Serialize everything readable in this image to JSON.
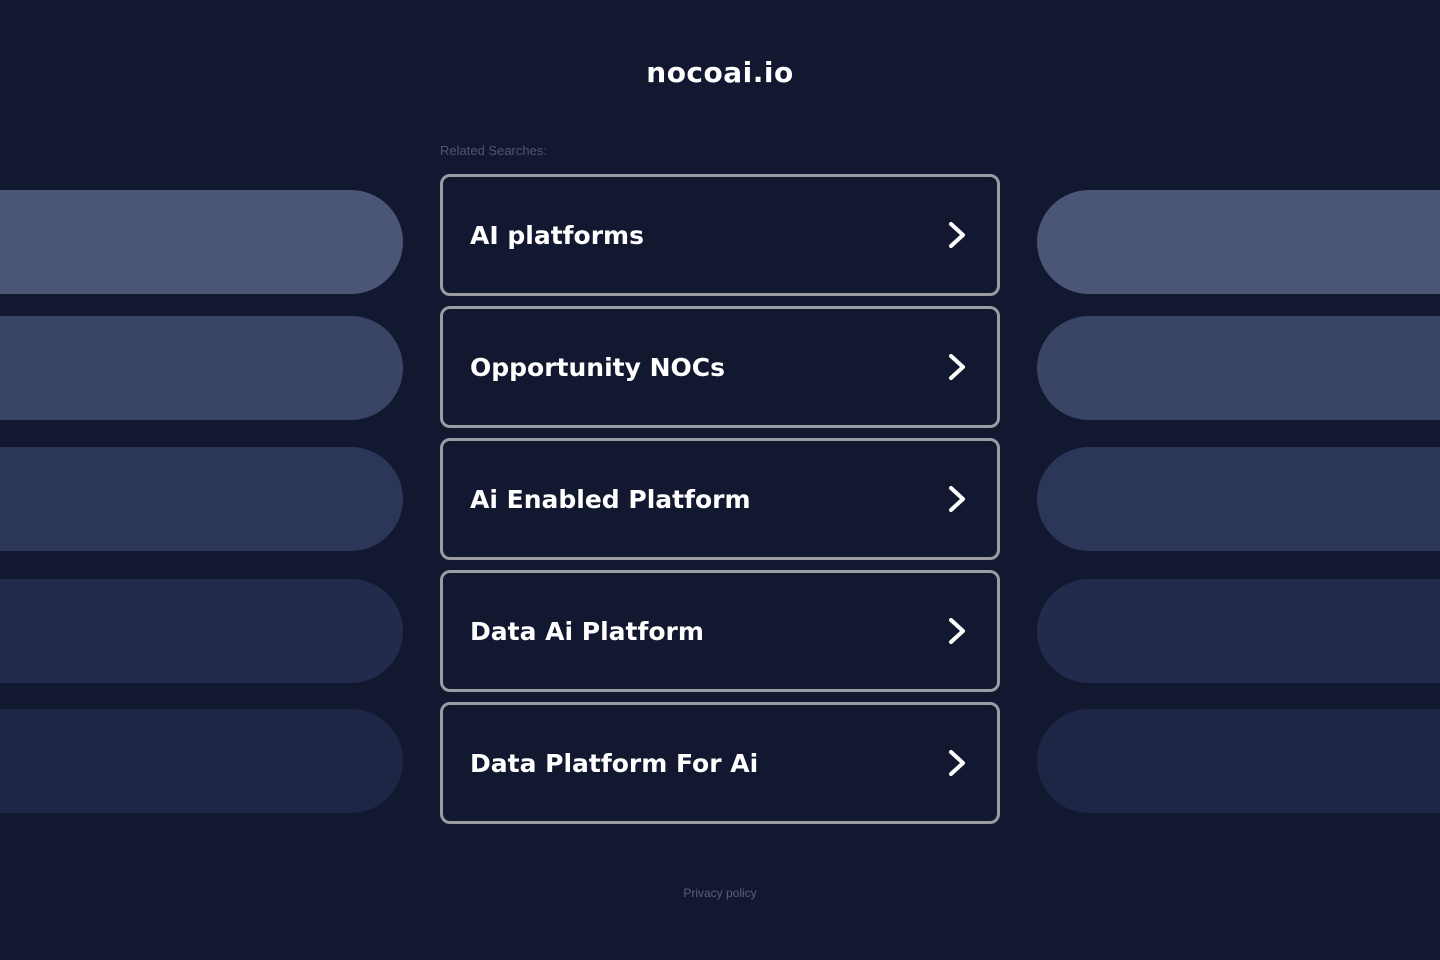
{
  "header": {
    "site_title": "nocoai.io"
  },
  "related": {
    "label": "Related Searches:",
    "items": [
      {
        "label": "AI platforms"
      },
      {
        "label": "Opportunity NOCs"
      },
      {
        "label": "Ai Enabled Platform"
      },
      {
        "label": "Data Ai Platform"
      },
      {
        "label": "Data Platform For Ai"
      }
    ]
  },
  "footer": {
    "privacy_label": "Privacy policy"
  },
  "colors": {
    "background": "#121830",
    "card_border": "#9a9ca3",
    "text": "#ffffff",
    "deco_1": "#4b5677",
    "deco_2": "#3a4566",
    "deco_3": "#2c3659",
    "deco_4": "#222b4b",
    "deco_5": "#1e2645"
  },
  "icons": {
    "result_arrow": "chevron-right-icon"
  }
}
